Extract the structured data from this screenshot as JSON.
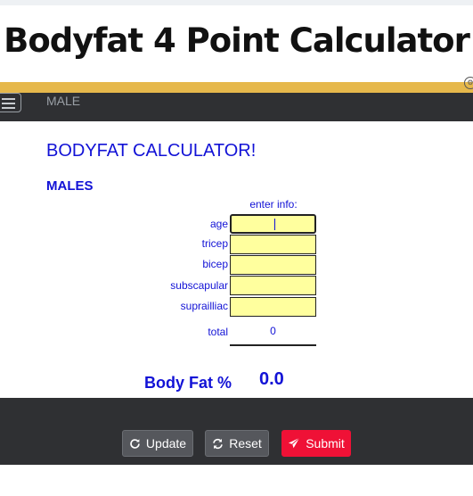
{
  "banner": {
    "title": "Bodyfat 4 Point Calculator"
  },
  "nav": {
    "label": "MALE"
  },
  "calculator": {
    "title": "BODYFAT CALCULATOR!",
    "subtitle": "MALES",
    "enter_info": "enter info:",
    "fields": [
      {
        "label": "age",
        "value": ""
      },
      {
        "label": "tricep",
        "value": ""
      },
      {
        "label": "bicep",
        "value": ""
      },
      {
        "label": "subscapular",
        "value": ""
      },
      {
        "label": "suprailliac",
        "value": ""
      }
    ],
    "total_label": "total",
    "total_value": "0",
    "bodyfat_label": "Body Fat %",
    "bodyfat_value": "0.0"
  },
  "buttons": {
    "update": "Update",
    "reset": "Reset",
    "submit": "Submit"
  },
  "colors": {
    "accent_blue": "#1212d6",
    "field_yellow": "#ffff9e",
    "gold_bar": "#e6b84b",
    "dark_bar": "#2f3033",
    "submit_red": "#ef1136"
  }
}
